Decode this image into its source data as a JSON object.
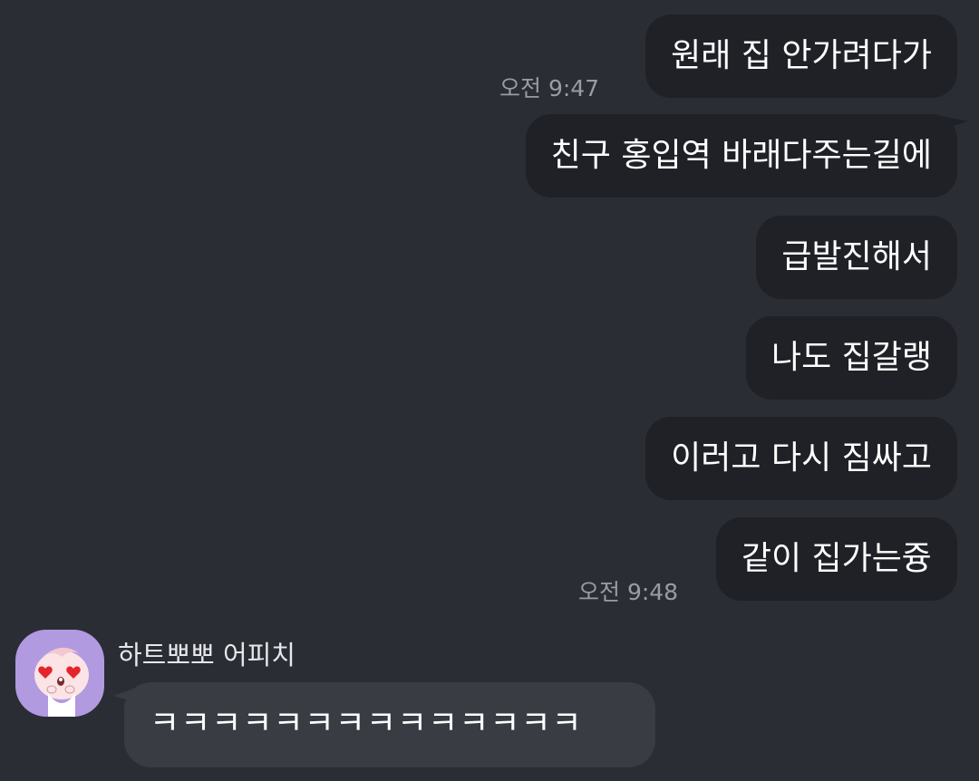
{
  "messages_outgoing": [
    {
      "text": "원래 집 안가려다가"
    },
    {
      "text": "친구 홍입역 바래다주는길에"
    },
    {
      "text": "급발진해서"
    },
    {
      "text": "나도 집갈랭"
    },
    {
      "text": "이러고 다시 짐싸고"
    },
    {
      "text": "같이 집가는즁"
    }
  ],
  "timestamps": {
    "first_group": "오전 9:47",
    "second_group": "오전 9:48"
  },
  "incoming": {
    "sender_name": "하트뽀뽀 어피치",
    "avatar_icon": "apeach-heart-eyes-icon",
    "text": "ㅋㅋㅋㅋㅋㅋㅋㅋㅋㅋㅋㅋㅋㅋ"
  },
  "colors": {
    "background": "#2a2d34",
    "outgoing_bubble": "#1f2127",
    "incoming_bubble": "#393c43",
    "timestamp": "#9a9ca3",
    "avatar_bg": "#b19ae0"
  }
}
